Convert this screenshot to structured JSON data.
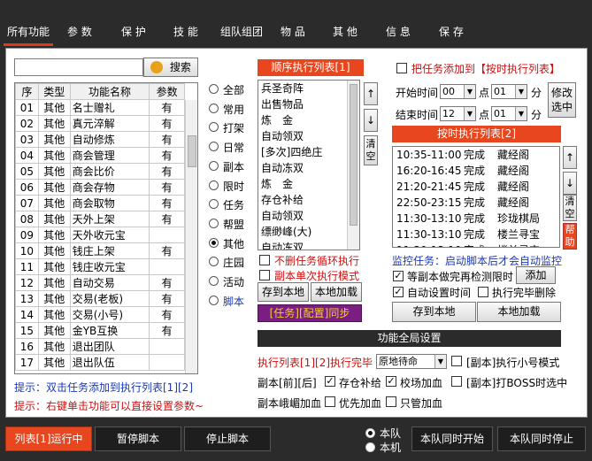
{
  "tabs": [
    "所有功能",
    "参 数",
    "保 护",
    "技 能",
    "组队组团",
    "物 品",
    "其 他",
    "信 息",
    "保 存"
  ],
  "search": {
    "value": "",
    "button": "搜索"
  },
  "func_table": {
    "headers": [
      "序",
      "类型",
      "功能名称",
      "参数"
    ],
    "rows": [
      [
        "01",
        "其他",
        "名士赠礼",
        "有"
      ],
      [
        "02",
        "其他",
        "真元淬解",
        "有"
      ],
      [
        "03",
        "其他",
        "自动修炼",
        "有"
      ],
      [
        "04",
        "其他",
        "商会管理",
        "有"
      ],
      [
        "05",
        "其他",
        "商会比价",
        "有"
      ],
      [
        "06",
        "其他",
        "商会存物",
        "有"
      ],
      [
        "07",
        "其他",
        "商会取物",
        "有"
      ],
      [
        "08",
        "其他",
        "天外上架",
        "有"
      ],
      [
        "09",
        "其他",
        "天外收元宝",
        ""
      ],
      [
        "10",
        "其他",
        "钱庄上架",
        "有"
      ],
      [
        "11",
        "其他",
        "钱庄收元宝",
        ""
      ],
      [
        "12",
        "其他",
        "自动交易",
        "有"
      ],
      [
        "13",
        "其他",
        "交易(老板)",
        "有"
      ],
      [
        "14",
        "其他",
        "交易(小号)",
        "有"
      ],
      [
        "15",
        "其他",
        "金YB互换",
        "有"
      ],
      [
        "16",
        "其他",
        "退出团队",
        ""
      ],
      [
        "17",
        "其他",
        "退出队伍",
        ""
      ]
    ]
  },
  "categories": [
    {
      "label": "全部",
      "on": false
    },
    {
      "label": "常用",
      "on": false
    },
    {
      "label": "打架",
      "on": false
    },
    {
      "label": "日常",
      "on": false
    },
    {
      "label": "副本",
      "on": false
    },
    {
      "label": "限时",
      "on": false
    },
    {
      "label": "任务",
      "on": false
    },
    {
      "label": "帮盟",
      "on": false
    },
    {
      "label": "其他",
      "on": true
    },
    {
      "label": "庄园",
      "on": false
    },
    {
      "label": "活动",
      "on": false
    },
    {
      "label": "脚本",
      "on": false
    }
  ],
  "seq": {
    "title": "顺序执行列表[1]",
    "items": [
      "兵圣奇阵",
      "出售物品",
      "炼　金",
      "自动领双",
      "[多次]四绝庄",
      "自动冻双",
      "炼　金",
      "存仓补给",
      "自动领双",
      "缥缈峰(大)",
      "自动冻双"
    ],
    "up": "↑",
    "down": "↓",
    "clear": "清空",
    "opt1": "不删任务循环执行",
    "opt2": "副本单次执行模式",
    "save": "存到本地",
    "load": "本地加载",
    "sync": "[任务][配置]同步"
  },
  "timed": {
    "add_to_label": "把任务添加到【按时执行列表】",
    "start_label": "开始时间",
    "end_label": "结束时间",
    "start_h": "00",
    "start_m": "01",
    "end_h": "12",
    "end_m": "01",
    "dian": "点",
    "fen": "分",
    "modify": "修改\n选中",
    "title": "按时执行列表[2]",
    "rows": [
      [
        "10:35-11:00",
        "完成",
        "藏经阁"
      ],
      [
        "16:20-16:45",
        "完成",
        "藏经阁"
      ],
      [
        "21:20-21:45",
        "完成",
        "藏经阁"
      ],
      [
        "22:50-23:15",
        "完成",
        "藏经阁"
      ],
      [
        "11:30-13:10",
        "完成",
        "珍珑棋局"
      ],
      [
        "11:30-13:10",
        "完成",
        "楼兰寻宝"
      ],
      [
        "11:30-13:10",
        "完成",
        "楼兰寻宝"
      ]
    ],
    "up": "↑",
    "down": "↓",
    "clear": "清空",
    "help": "帮助",
    "monitor": "监控任务：启动脚本后才会自动监控",
    "wait": "等副本做完再检测限时",
    "add": "添加",
    "auto_time": "自动设置时间",
    "done_delete": "执行完毕删除",
    "save": "存到本地",
    "load": "本地加载"
  },
  "global": {
    "title": "功能全局设置",
    "exec_label": "执行列表[1][2]执行完毕",
    "exec_value": "原地待命",
    "small_mode": "[副本]执行小号模式",
    "fb_before_after": "副本[前][后]",
    "store": "存仓补给",
    "field_add": "校场加血",
    "boss": "[副本]打BOSS时选中",
    "fb_add": "副本峨嵋加血",
    "priority_add": "优先加血",
    "only_add": "只管加血"
  },
  "hints": {
    "hint1": "提示：双击任务添加到执行列表[1][2]",
    "hint2": "提示：右键单击功能可以直接设置参数~"
  },
  "bottom": {
    "run": "列表[1]运行中",
    "pause": "暂停脚本",
    "stop": "停止脚本",
    "team": "本队",
    "self": "本机",
    "start_team": "本队同时开始",
    "stop_team": "本队同时停止"
  },
  "colors": {
    "accent": "#e8461e",
    "dark": "#2b2b2b",
    "hint": "#1b38b8",
    "hint_red": "#d01010"
  }
}
